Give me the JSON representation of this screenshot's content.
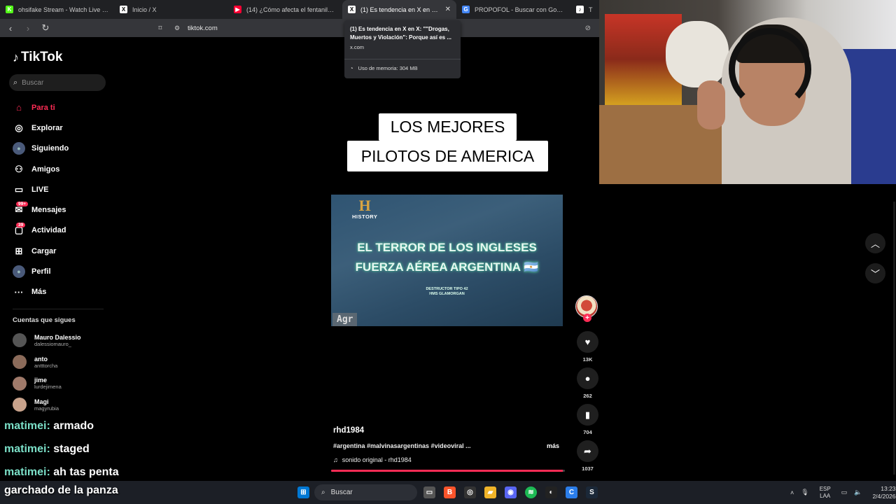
{
  "browser": {
    "tabs": [
      {
        "title": "ohsifake Stream - Watch Live on",
        "favicon": "kick-icon",
        "color": "#53fc18",
        "active": false
      },
      {
        "title": "Inicio / X",
        "favicon": "x-icon",
        "color": "#ffffff",
        "active": false
      },
      {
        "title": "(14) ¿Cómo afecta el fentanilo al cue",
        "favicon": "youtube-icon",
        "color": "#ff0033",
        "active": false
      },
      {
        "title": "(1) Es tendencia en X en X: \"\"Dr",
        "favicon": "x-icon",
        "color": "#ffffff",
        "active": true
      },
      {
        "title": "PROPOFOL - Buscar con Google",
        "favicon": "google-icon",
        "color": "#4285f4",
        "active": false
      },
      {
        "title": "Tik",
        "favicon": "tiktok-icon",
        "color": "#ffffff",
        "active": false
      }
    ],
    "url": "tiktok.com",
    "hovercard": {
      "title": "(1) Es tendencia en X en X: \"\"Drogas, Muertos y Violación\": Porque así es ...",
      "domain": "x.com",
      "memory": "Uso de memoria: 304 MB"
    }
  },
  "tiktok": {
    "logo": "TikTok",
    "search_placeholder": "Buscar",
    "menu": [
      {
        "label": "Para ti",
        "icon": "home-icon",
        "glyph": "⌂",
        "active": true
      },
      {
        "label": "Explorar",
        "icon": "compass-icon",
        "glyph": "◎",
        "active": false
      },
      {
        "label": "Siguiendo",
        "icon": "following-avatar-icon",
        "glyph": "●",
        "active": false
      },
      {
        "label": "Amigos",
        "icon": "friends-icon",
        "glyph": "⚇",
        "active": false
      },
      {
        "label": "LIVE",
        "icon": "live-tv-icon",
        "glyph": "▭",
        "active": false
      },
      {
        "label": "Mensajes",
        "icon": "messages-icon",
        "glyph": "✉",
        "active": false,
        "badge": "99+"
      },
      {
        "label": "Actividad",
        "icon": "activity-icon",
        "glyph": "▢",
        "active": false,
        "badge": "39"
      },
      {
        "label": "Cargar",
        "icon": "upload-icon",
        "glyph": "⊞",
        "active": false
      },
      {
        "label": "Perfil",
        "icon": "profile-icon",
        "glyph": "●",
        "active": false
      },
      {
        "label": "Más",
        "icon": "more-icon",
        "glyph": "···",
        "active": false
      }
    ],
    "following_title": "Cuentas que sigues",
    "following": [
      {
        "name": "Mauro Dalessio",
        "user": "dalessiomauro_",
        "color": "#555"
      },
      {
        "name": "anto",
        "user": "antttorcha",
        "color": "#8b6b5a"
      },
      {
        "name": "jime",
        "user": "lurdejimena",
        "color": "#a07a6a"
      },
      {
        "name": "Magi",
        "user": "magyrubia",
        "color": "#c9a38c"
      }
    ],
    "video": {
      "caption_line1": "LOS MEJORES",
      "caption_line2": "PILOTOS DE AMERICA",
      "channel_logo": "H",
      "channel_name": "HISTORY",
      "title_line1": "EL TERROR DE LOS INGLESES",
      "title_line2": "FUERZA AÉREA ARGENTINA 🇦🇷",
      "subtitle_line1": "DESTRUCTOR TIPO 42",
      "subtitle_line2": "HMS GLAMORGAN",
      "watermark": "Agr",
      "author": "rhd1984",
      "description": "#argentina #malvinasargentinas #videoviral ...",
      "more": "más",
      "sound": "sonido original - rhd1984",
      "progress_percent": 99
    },
    "actions": {
      "likes": "13K",
      "comments": "262",
      "saves": "704",
      "shares": "1037"
    }
  },
  "chat": [
    {
      "user": "matimei:",
      "message": "armado"
    },
    {
      "user": "matimei:",
      "message": "staged"
    },
    {
      "user": "matimei:",
      "message": "ah tas penta"
    }
  ],
  "chat_last": "garchado de la panza",
  "taskbar": {
    "search": "Buscar",
    "lang_line1": "ESP",
    "lang_line2": "LAA",
    "time": "13:23",
    "date": "2/4/2026"
  }
}
